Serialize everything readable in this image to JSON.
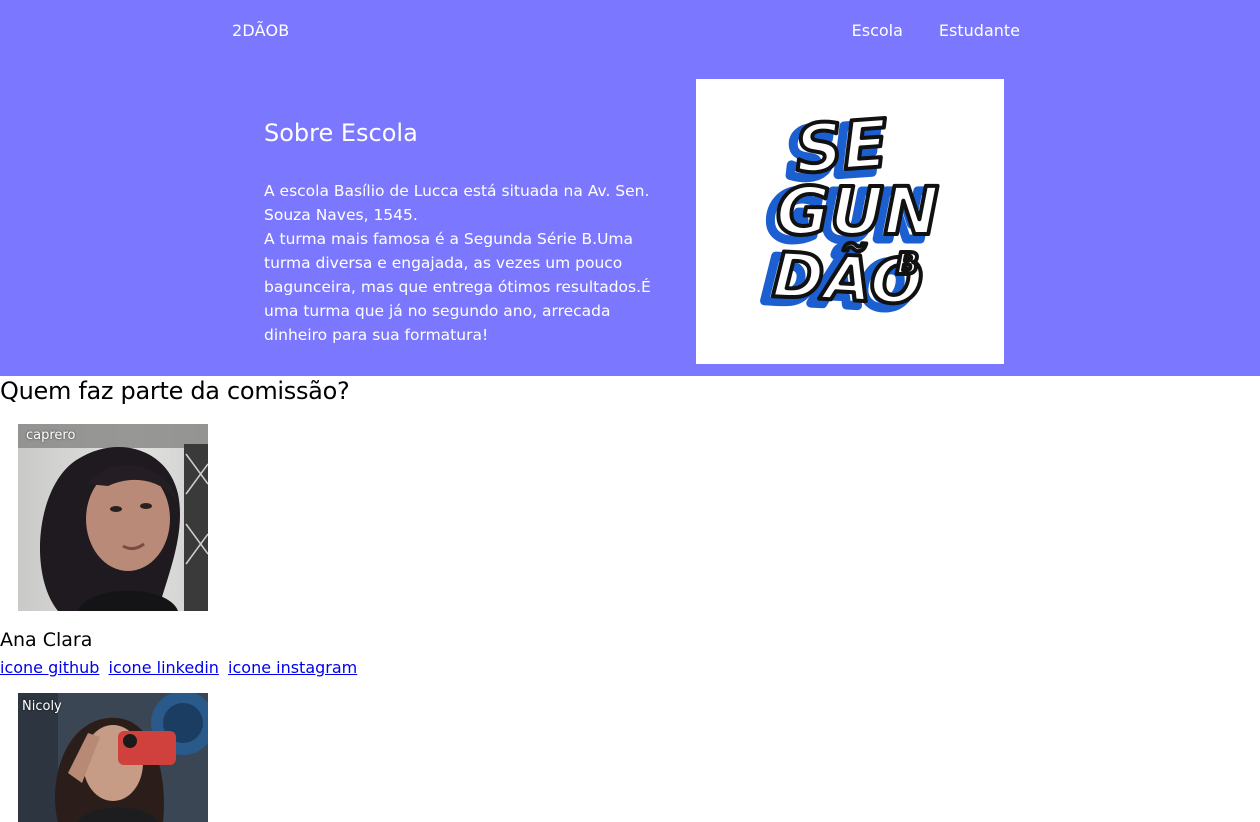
{
  "header": {
    "brand": "2DÃOB",
    "nav": [
      "Escola",
      "Estudante"
    ]
  },
  "about": {
    "title": "Sobre Escola",
    "paragraph_lines": [
      "A escola Basílio de Lucca está situada na Av. Sen. Souza Naves, 1545.",
      "A turma mais famosa é a Segunda Série B.Uma turma diversa e engajada, as vezes um pouco bagunceira, mas que entrega ótimos resultados.É uma turma que já no segundo ano, arrecada dinheiro para sua formatura!"
    ],
    "logo_text": [
      "SE",
      "GUN",
      "DÃO",
      "B"
    ]
  },
  "commission": {
    "title": "Quem faz parte da comissão?",
    "members": [
      {
        "photo_tag": "caprero",
        "name": "Ana Clara",
        "links": [
          "icone github",
          "icone linkedin",
          "icone instagram"
        ]
      },
      {
        "photo_tag": "Nicoly"
      }
    ]
  },
  "colors": {
    "hero_background": "#7b78ff",
    "link": "#0000ee"
  }
}
